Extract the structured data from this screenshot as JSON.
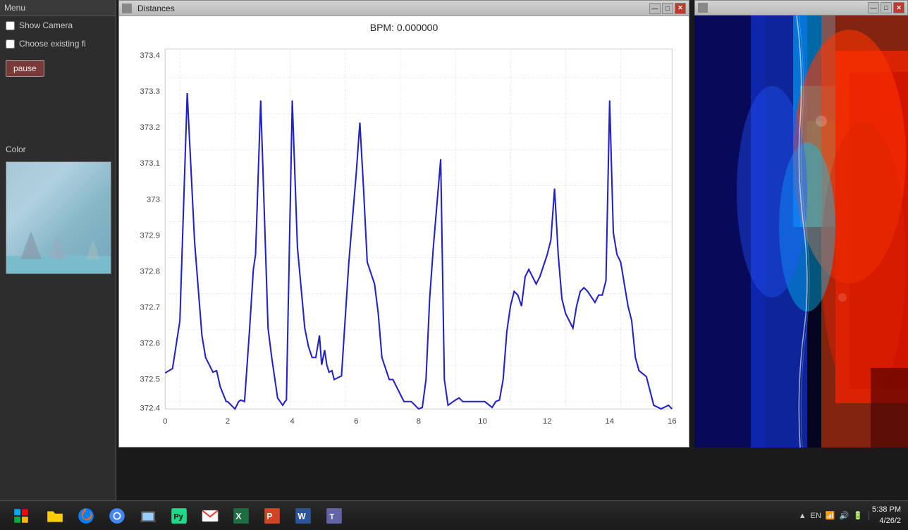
{
  "sidebar": {
    "title": "Menu",
    "show_camera_label": "Show Camera",
    "choose_existing_label": "Choose existing fi",
    "pause_label": "pause",
    "color_label": "Color"
  },
  "distances_window": {
    "title": "Distances",
    "bpm_label": "BPM: 0.000000",
    "y_axis": {
      "max": 373.4,
      "values": [
        "373.4",
        "373.3",
        "373.2",
        "373.1",
        "373",
        "372.9",
        "372.8",
        "372.7",
        "372.6",
        "372.5",
        "372.4"
      ]
    },
    "x_axis": {
      "values": [
        "0",
        "2",
        "4",
        "6",
        "8",
        "10",
        "12",
        "14",
        "16"
      ]
    }
  },
  "taskbar": {
    "buttons": [
      {
        "name": "start-button",
        "label": "⊞"
      },
      {
        "name": "file-manager-button",
        "label": "📁"
      },
      {
        "name": "firefox-button",
        "label": "🦊"
      },
      {
        "name": "chrome-button",
        "label": "🌐"
      },
      {
        "name": "explorer-button",
        "label": "🗂"
      },
      {
        "name": "pycharm-button",
        "label": "🖥"
      },
      {
        "name": "gmail-button",
        "label": "✉"
      },
      {
        "name": "excel-button",
        "label": "📊"
      },
      {
        "name": "powerpoint-button",
        "label": "📊"
      },
      {
        "name": "word-button",
        "label": "📄"
      },
      {
        "name": "teams-button",
        "label": "📋"
      }
    ],
    "tray": {
      "lang": "EN",
      "time": "5:38 PM",
      "date": "4/26/2"
    }
  },
  "colors": {
    "line_color": "#2222cc",
    "chart_bg": "#ffffff",
    "grid_color": "#dddddd"
  }
}
